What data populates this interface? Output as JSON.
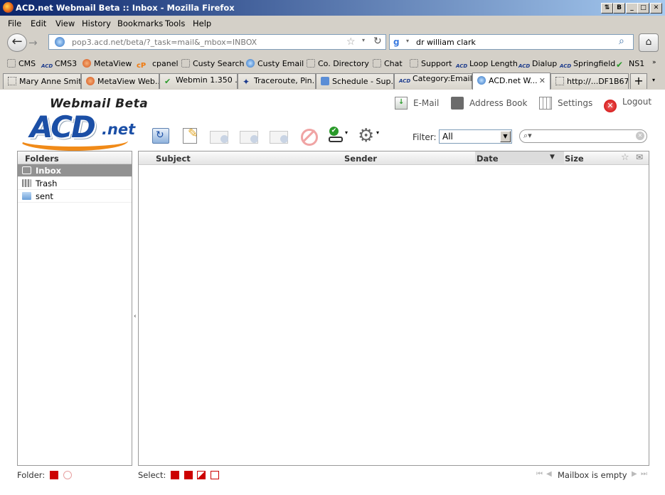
{
  "window": {
    "title": "ACD.net Webmail Beta :: Inbox - Mozilla Firefox"
  },
  "menu": [
    "File",
    "Edit",
    "View",
    "History",
    "Bookmarks",
    "Tools",
    "Help"
  ],
  "url": "pop3.acd.net/beta/?_task=mail&_mbox=INBOX",
  "search": {
    "value": "dr william clark"
  },
  "bookmarks": [
    "CMS",
    "CMS3",
    "MetaView",
    "cpanel",
    "Custy Search",
    "Custy Email",
    "Co. Directory",
    "Chat",
    "Support",
    "Loop Length",
    "Dialup",
    "Springfield",
    "NS1"
  ],
  "tabs": [
    "Mary Anne Smith",
    "MetaView Web...",
    "Webmin 1.350 ...",
    "Traceroute, Pin...",
    "Schedule - Sup...",
    "Category:Email...",
    "ACD.net W...",
    "http://...DF1B67"
  ],
  "webmail": {
    "logo_beta": "Webmail Beta",
    "logo_acd": "ACD",
    "logo_net": ".net",
    "nav": [
      "E-Mail",
      "Address Book",
      "Settings",
      "Logout"
    ],
    "filter_label": "Filter:",
    "filter_value": "All",
    "folders_header": "Folders",
    "folders": [
      "Inbox",
      "Trash",
      "sent"
    ],
    "columns": {
      "subject": "Subject",
      "sender": "Sender",
      "date": "Date",
      "size": "Size"
    },
    "footer": {
      "folder_label": "Folder:",
      "select_label": "Select:",
      "count": "Mailbox is empty"
    }
  },
  "colors": {
    "titlebar": "#0a246a",
    "accent": "#1b4fa6",
    "logo_orange": "#f08a18",
    "selected_folder": "#929292"
  }
}
